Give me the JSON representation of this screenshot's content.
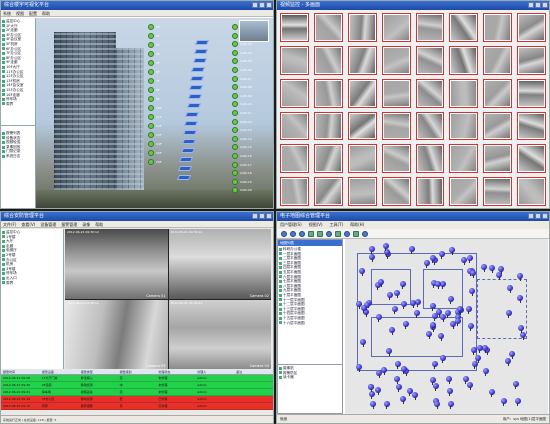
{
  "colors": {
    "alarm_green": "#22d04a",
    "alarm_red": "#e8302a",
    "title_bar": "#1d4aa8"
  },
  "q1": {
    "title": "综合楼宇可视化平台",
    "menu": [
      "系统",
      "视图",
      "配置",
      "帮助"
    ],
    "tree": [
      "监控中心",
      "1F大厅",
      "2F走廊",
      "3F办公区",
      "4F会议室",
      "5F机房",
      "6F办公区",
      "7F办公区",
      "8F办公区",
      "9F走廊",
      "10F大厅",
      "11F办公区",
      "12F办公区",
      "13F机房",
      "14F会议室",
      "15F办公区",
      "16F走廊",
      "停车场",
      "周界"
    ],
    "panel2": [
      "报警列表",
      "设备状态",
      "视频轮巡",
      "录像回放",
      "门禁记录",
      "系统日志"
    ],
    "devices_left": [
      "1F",
      "2F",
      "3F",
      "4F",
      "5F",
      "6F",
      "7F",
      "8F",
      "9F",
      "10F",
      "11F",
      "12F",
      "13F",
      "14F",
      "15F",
      "16F"
    ],
    "devices_right": [
      "CAM-01",
      "CAM-02",
      "CAM-03",
      "CAM-04",
      "CAM-05",
      "CAM-06",
      "CAM-07",
      "CAM-08",
      "CAM-09",
      "CAM-10",
      "CAM-11",
      "CAM-12",
      "CAM-13",
      "CAM-14",
      "CAM-15",
      "CAM-16",
      "CAM-17",
      "CAM-18",
      "CAM-19",
      "CAM-20"
    ]
  },
  "q2": {
    "title": "视频监控 - 多画面"
  },
  "q3": {
    "title": "综合安防管理平台",
    "menu": [
      "文件(F)",
      "查看(V)",
      "设备管理",
      "报警管理",
      "录像",
      "帮助"
    ],
    "tree": [
      "监控中心",
      "1号楼",
      "大厅",
      "走廊",
      "电梯厅",
      "2号楼",
      "办公区",
      "机房",
      "3号楼",
      "停车场",
      "出入口",
      "周界"
    ],
    "videos": [
      {
        "ts": "2012-06-21 09:30:12",
        "cam": "Camera 01"
      },
      {
        "ts": "2012-06-21 09:30:12",
        "cam": "Camera 02"
      },
      {
        "ts": "2012-06-21 09:30:12",
        "cam": "Camera 03"
      },
      {
        "ts": "2012-06-21 09:30:12",
        "cam": "Camera 04"
      }
    ],
    "headers": [
      "报警时间",
      "报警设备",
      "报警类型",
      "报警级别",
      "处理状态",
      "处理人",
      "备注"
    ],
    "rows": [
      [
        "2012-06-21 09:28",
        "1F大厅门禁",
        "非法闯入",
        "高",
        "未处理",
        "admin",
        ""
      ],
      [
        "2012-06-21 09:25",
        "2F走廊",
        "移动侦测",
        "中",
        "未处理",
        "admin",
        ""
      ],
      [
        "2012-06-21 09:21",
        "停车场",
        "视频丢失",
        "高",
        "未处理",
        "admin",
        ""
      ],
      [
        "2012-06-21 09:18",
        "3F办公区",
        "移动侦测",
        "低",
        "已处理",
        "admin",
        ""
      ],
      [
        "2012-06-21 09:12",
        "周界",
        "越界报警",
        "高",
        "已处理",
        "admin",
        ""
      ]
    ],
    "status": "系统运行正常 | 在线设备: 128 | 报警: 5"
  },
  "q4": {
    "title": "电子地图综合管理平台",
    "menu": [
      "用户管理(S)",
      "视图(V)",
      "工具(T)",
      "帮助(H)"
    ],
    "side_header": "地图列表",
    "tree": [
      "科研办公楼",
      "一层平面图",
      "二层平面图",
      "三层平面图",
      "四层平面图",
      "五层平面图",
      "六层平面图",
      "七层平面图",
      "八层平面图",
      "九层平面图",
      "十层平面图",
      "十一层平面图",
      "十二层平面图",
      "十三层平面图",
      "十四层平面图",
      "十五层平面图",
      "十六层平面图"
    ],
    "tree2": [
      "摄像机",
      "报警防区",
      "读卡器"
    ],
    "status_left": "就绪",
    "status_right": "用户：sys 地图(1)层平面图"
  }
}
